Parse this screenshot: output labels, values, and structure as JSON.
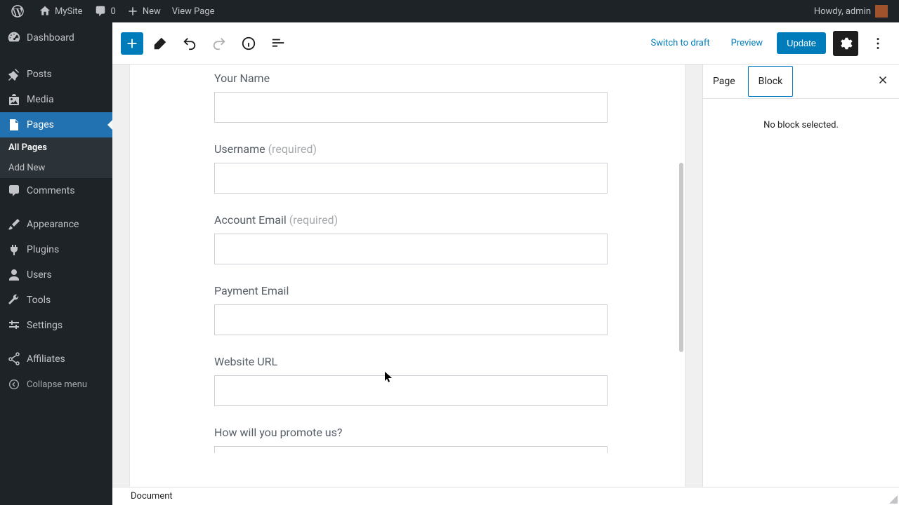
{
  "adminbar": {
    "site_name": "MySite",
    "comments_count": "0",
    "new_label": "New",
    "view_page_label": "View Page",
    "howdy": "Howdy, admin"
  },
  "sidemenu": {
    "dashboard": "Dashboard",
    "posts": "Posts",
    "media": "Media",
    "pages": "Pages",
    "pages_sub": {
      "all": "All Pages",
      "add": "Add New"
    },
    "comments": "Comments",
    "appearance": "Appearance",
    "plugins": "Plugins",
    "users": "Users",
    "tools": "Tools",
    "settings": "Settings",
    "affiliates": "Affiliates",
    "collapse": "Collapse menu"
  },
  "toolbar": {
    "switch_draft": "Switch to draft",
    "preview": "Preview",
    "update": "Update"
  },
  "panel": {
    "tab_page": "Page",
    "tab_block": "Block",
    "no_block": "No block selected."
  },
  "form": {
    "fields": [
      {
        "label": "Your Name",
        "required": ""
      },
      {
        "label": "Username",
        "required": "(required)"
      },
      {
        "label": "Account Email",
        "required": "(required)"
      },
      {
        "label": "Payment Email",
        "required": ""
      },
      {
        "label": "Website URL",
        "required": ""
      },
      {
        "label": "How will you promote us?",
        "required": ""
      }
    ]
  },
  "footer": {
    "breadcrumb": "Document"
  }
}
